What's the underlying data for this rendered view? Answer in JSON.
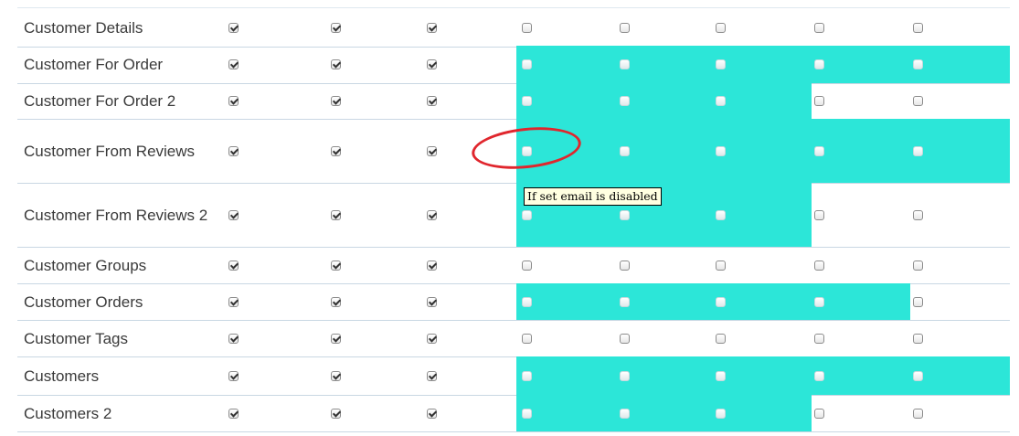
{
  "columns_count": 9,
  "rows": [
    {
      "label": "Customer Details",
      "checked": [
        true,
        true,
        true,
        false,
        false,
        false,
        false,
        false
      ],
      "highlight": [
        false,
        false,
        false,
        false,
        false
      ]
    },
    {
      "label": "Customer For Order",
      "checked": [
        true,
        true,
        true,
        false,
        false,
        false,
        false,
        false
      ],
      "highlight": [
        true,
        true,
        true,
        true,
        true
      ]
    },
    {
      "label": "Customer For Order 2",
      "checked": [
        true,
        true,
        true,
        false,
        false,
        false,
        false,
        false
      ],
      "highlight": [
        true,
        true,
        true,
        false,
        false
      ]
    },
    {
      "label": "Customer From Reviews",
      "checked": [
        true,
        true,
        true,
        false,
        false,
        false,
        false,
        false
      ],
      "highlight": [
        true,
        true,
        true,
        true,
        true
      ]
    },
    {
      "label": "Customer From Reviews 2",
      "checked": [
        true,
        true,
        true,
        false,
        false,
        false,
        false,
        false
      ],
      "highlight": [
        true,
        true,
        true,
        false,
        false
      ]
    },
    {
      "label": "Customer Groups",
      "checked": [
        true,
        true,
        true,
        false,
        false,
        false,
        false,
        false
      ],
      "highlight": [
        false,
        false,
        false,
        false,
        false
      ]
    },
    {
      "label": "Customer Orders",
      "checked": [
        true,
        true,
        true,
        false,
        false,
        false,
        false,
        false
      ],
      "highlight": [
        true,
        true,
        true,
        true,
        false
      ]
    },
    {
      "label": "Customer Tags",
      "checked": [
        true,
        true,
        true,
        false,
        false,
        false,
        false,
        false
      ],
      "highlight": [
        false,
        false,
        false,
        false,
        false
      ]
    },
    {
      "label": "Customers",
      "checked": [
        true,
        true,
        true,
        false,
        false,
        false,
        false,
        false
      ],
      "highlight": [
        true,
        true,
        true,
        true,
        true
      ]
    },
    {
      "label": "Customers 2",
      "checked": [
        true,
        true,
        true,
        false,
        false,
        false,
        false,
        false
      ],
      "highlight": [
        true,
        true,
        true,
        false,
        false
      ]
    }
  ],
  "tooltip": {
    "text": "If set email is disabled"
  },
  "colors": {
    "highlight": "#2ce6d8",
    "annotation": "#e0262d",
    "tooltip_bg": "#ffffe1"
  }
}
